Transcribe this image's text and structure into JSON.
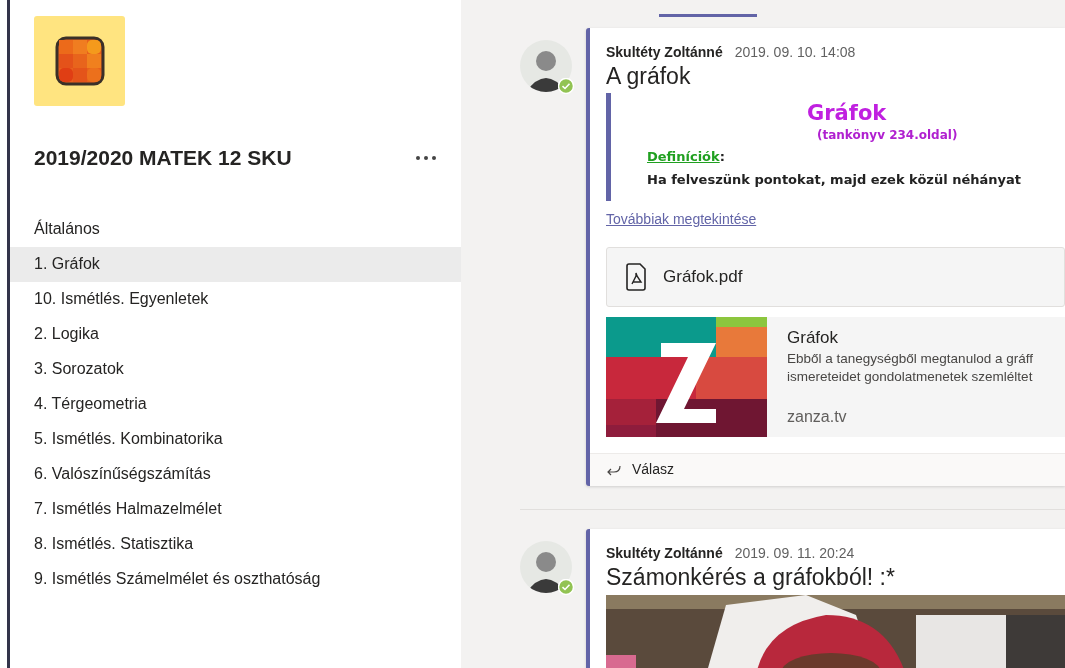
{
  "sidebar": {
    "team_name": "2019/2020 MATEK 12 SKU",
    "channels": [
      {
        "label": "Általános",
        "selected": false
      },
      {
        "label": "1. Gráfok",
        "selected": true
      },
      {
        "label": "10. Ismétlés. Egyenletek",
        "selected": false
      },
      {
        "label": "2. Logika",
        "selected": false
      },
      {
        "label": "3. Sorozatok",
        "selected": false
      },
      {
        "label": "4. Térgeometria",
        "selected": false
      },
      {
        "label": "5. Ismétlés. Kombinatorika",
        "selected": false
      },
      {
        "label": "6. Valószínűségszámítás",
        "selected": false
      },
      {
        "label": "7. Ismétlés Halmazelmélet",
        "selected": false
      },
      {
        "label": "8. Ismétlés. Statisztika",
        "selected": false
      },
      {
        "label": "9. Ismétlés Számelmélet és oszthatóság",
        "selected": false
      }
    ]
  },
  "posts": [
    {
      "author": "Skultéty Zoltánné",
      "time": "2019. 09. 10. 14:08",
      "online": true,
      "subject": "A gráfok",
      "document": {
        "heading": "Gráfok",
        "subheading": "(tankönyv 234.oldal)",
        "label": "Definíciók",
        "label_suffix": ":",
        "line": "Ha felveszünk pontokat, majd ezek közül néhányat"
      },
      "see_more": "Továbbiak megtekintése",
      "attachment": {
        "name": "Gráfok.pdf"
      },
      "link_preview": {
        "title": "Gráfok",
        "description": [
          "Ebből a tanegységből megtanulod a gráff",
          "ismereteidet gondolatmenetek szemléltet"
        ],
        "site": "zanza.tv"
      },
      "reply": "Válasz"
    },
    {
      "author": "Skultéty Zoltánné",
      "time": "2019. 09. 11. 20:24",
      "online": true,
      "subject": "Számonkérés a gráfokból! :*"
    }
  ]
}
